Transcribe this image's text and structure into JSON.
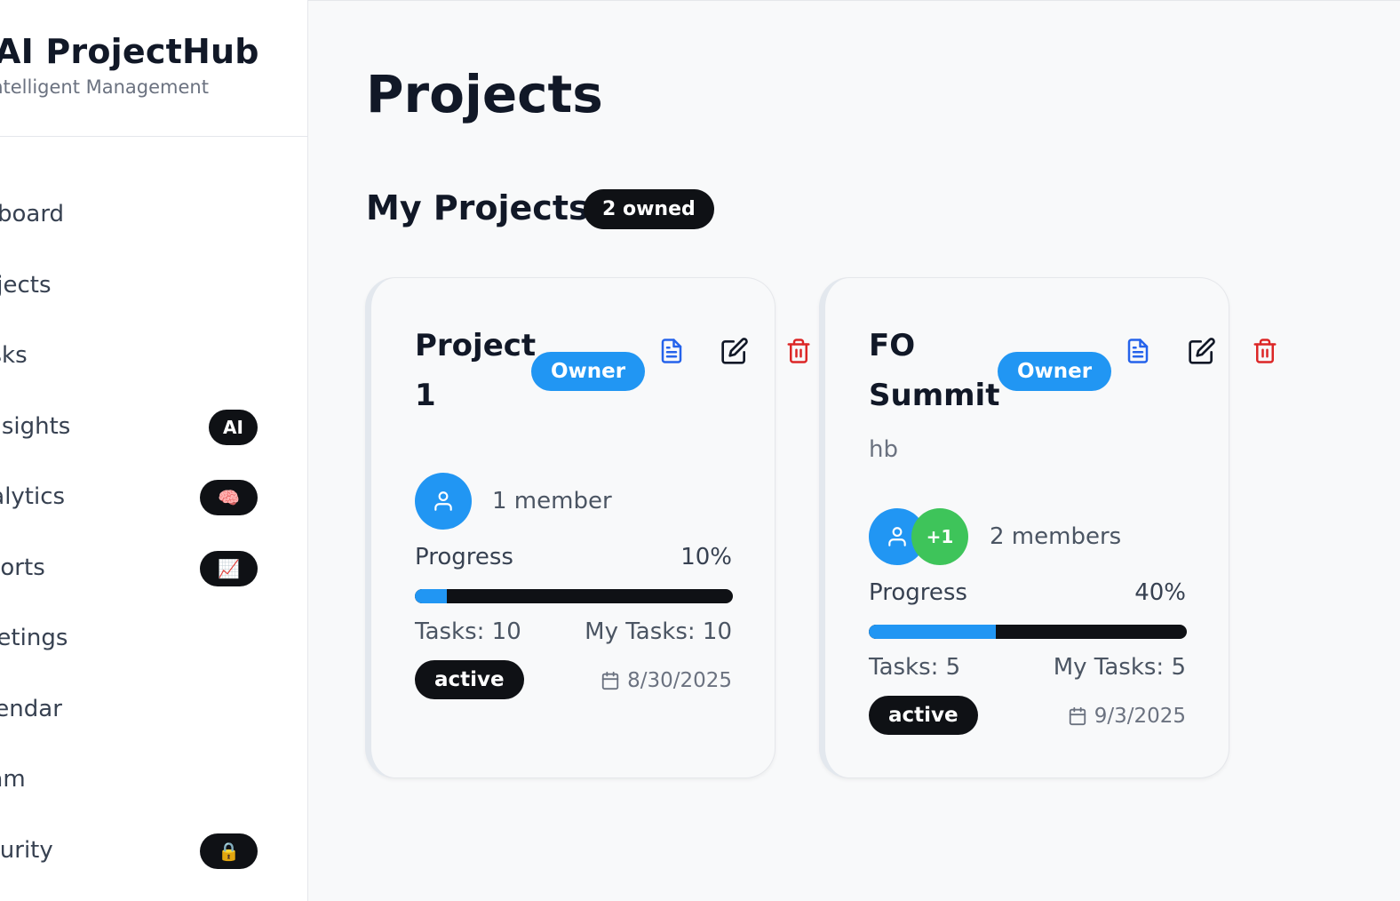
{
  "brand": {
    "title": "AI ProjectHub",
    "subtitle": "Intelligent Management"
  },
  "sidebar": {
    "items": [
      {
        "label": "Dashboard",
        "badge": null
      },
      {
        "label": "Projects",
        "badge": null
      },
      {
        "label": "Tasks",
        "badge": null
      },
      {
        "label": "AI Insights",
        "badge": "AI"
      },
      {
        "label": "Analytics",
        "badge": "🧠"
      },
      {
        "label": "Reports",
        "badge": "📈"
      },
      {
        "label": "Meetings",
        "badge": null
      },
      {
        "label": "Calendar",
        "badge": null
      },
      {
        "label": "Team",
        "badge": null
      },
      {
        "label": "Security",
        "badge": "🔒"
      }
    ]
  },
  "page": {
    "title": "Projects"
  },
  "section": {
    "title": "My Projects",
    "owned_badge": "2 owned"
  },
  "projects": [
    {
      "title": "Project 1",
      "role": "Owner",
      "description": "",
      "members_label": "1 member",
      "extra_members": null,
      "progress_label": "Progress",
      "progress_text": "10%",
      "progress": 0.1,
      "tasks_label": "Tasks: 10",
      "my_tasks_label": "My Tasks: 10",
      "status": "active",
      "date": "8/30/2025"
    },
    {
      "title": "FO Summit",
      "role": "Owner",
      "description": "hb",
      "members_label": "2 members",
      "extra_members": "+1",
      "progress_label": "Progress",
      "progress_text": "40%",
      "progress": 0.4,
      "tasks_label": "Tasks: 5",
      "my_tasks_label": "My Tasks: 5",
      "status": "active",
      "date": "9/3/2025"
    }
  ],
  "colors": {
    "accent": "#2196f3",
    "dark": "#0f1115",
    "success": "#3ec45a",
    "danger": "#dc2626",
    "doc_icon": "#2563eb"
  },
  "icons": {
    "document": "file-text-icon",
    "edit": "edit-icon",
    "delete": "trash-icon",
    "user": "user-icon",
    "date": "calendar-icon"
  }
}
